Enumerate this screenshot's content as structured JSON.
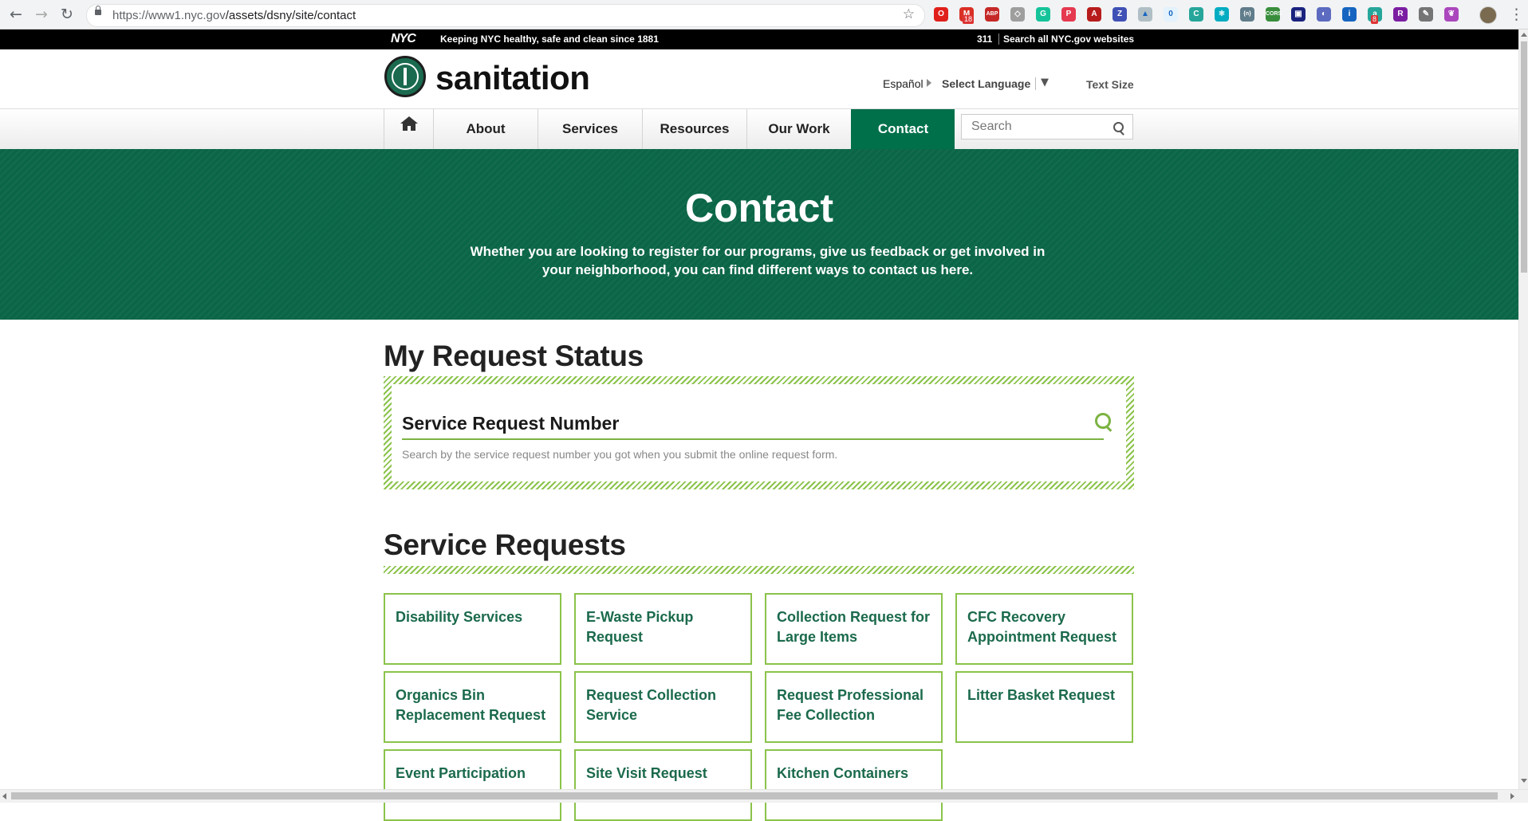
{
  "browser": {
    "url_host": "https://www1.nyc.gov",
    "url_path": "/assets/dsny/site/contact",
    "nav": {
      "back": "←",
      "forward": "→",
      "reload": "↻",
      "star": "☆",
      "menu": "⋮"
    },
    "extensions": [
      {
        "icon": "opera-icon",
        "color": "#e0201b",
        "text": "O"
      },
      {
        "icon": "gmail-icon",
        "color": "#d93025",
        "text": "M",
        "badge": "18"
      },
      {
        "icon": "adblock-icon",
        "color": "#c62828",
        "text": "ABP"
      },
      {
        "icon": "shield-icon",
        "color": "#9e9e9e",
        "text": "◇"
      },
      {
        "icon": "grammarly-icon",
        "color": "#15c39a",
        "text": "G"
      },
      {
        "icon": "pocket-icon",
        "color": "#e53950",
        "text": "P"
      },
      {
        "icon": "pdf-icon",
        "color": "#b71c1c",
        "text": "A"
      },
      {
        "icon": "zotero-icon",
        "color": "#3f51b5",
        "text": "Z"
      },
      {
        "icon": "bookmark-icon",
        "color": "#b0bec5",
        "text": "▲"
      },
      {
        "icon": "counter-icon",
        "color": "#e3f2fd",
        "text": "0"
      },
      {
        "icon": "c-icon",
        "color": "#26a69a",
        "text": "C"
      },
      {
        "icon": "react-icon",
        "color": "#00acc1",
        "text": "⚛"
      },
      {
        "icon": "json-icon",
        "color": "#607d8b",
        "text": "{n}"
      },
      {
        "icon": "cors-icon",
        "color": "#388e3c",
        "text": "CORS"
      },
      {
        "icon": "pixel-icon",
        "color": "#1a237e",
        "text": "▣"
      },
      {
        "icon": "compass-icon",
        "color": "#5c6bc0",
        "text": "◐"
      },
      {
        "icon": "info-icon",
        "color": "#1565c0",
        "text": "i"
      },
      {
        "icon": "a-icon",
        "color": "#26a69a",
        "text": "a",
        "badge": "8"
      },
      {
        "icon": "r-icon",
        "color": "#7b1fa2",
        "text": "R"
      },
      {
        "icon": "eyedropper-icon",
        "color": "#757575",
        "text": "✎"
      },
      {
        "icon": "butterfly-icon",
        "color": "#ab47bc",
        "text": "❦"
      }
    ]
  },
  "nycbar": {
    "logo": "NYC",
    "tagline": "Keeping NYC healthy, safe and clean since 1881",
    "phone": "311",
    "search_all": "Search all NYC.gov websites"
  },
  "header": {
    "brand": "sanitation",
    "espanol": "Español",
    "select_language": "Select Language",
    "select_caret": "▼",
    "text_size": "Text Size"
  },
  "nav": {
    "items": [
      {
        "label": "About"
      },
      {
        "label": "Services"
      },
      {
        "label": "Resources"
      },
      {
        "label": "Our Work"
      },
      {
        "label": "Contact",
        "active": true
      }
    ],
    "search_placeholder": "Search"
  },
  "hero": {
    "title": "Contact",
    "subtitle": "Whether you are looking to register for our programs, give us feedback or get involved in your neighborhood, you can find different ways to contact us here."
  },
  "request_status": {
    "heading": "My Request Status",
    "field_label": "Service Request Number",
    "help": "Search by the service request number you got when you submit the online request form."
  },
  "service_requests": {
    "heading": "Service Requests",
    "cards": [
      "Disability Services",
      "E-Waste Pickup Request",
      "Collection Request for Large Items",
      "CFC Recovery Appointment Request",
      "Organics Bin Replacement Request",
      "Request Collection Service",
      "Request Professional Fee Collection",
      "Litter Basket Request",
      "Event Participation",
      "Site Visit Request",
      "Kitchen Containers"
    ]
  },
  "colors": {
    "brand_green": "#00704a",
    "hero_green": "#0b6648",
    "accent_lime": "#8bc34a",
    "card_text": "#1b6a4c"
  }
}
